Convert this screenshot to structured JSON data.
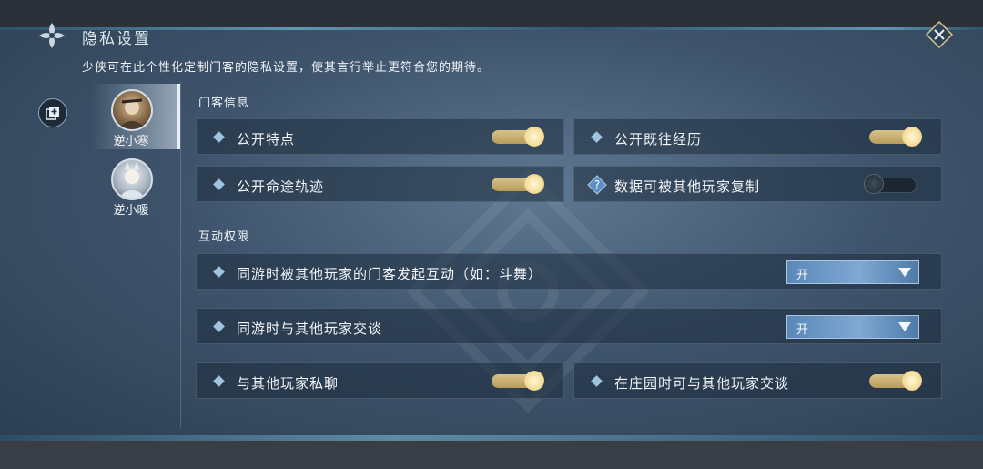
{
  "header": {
    "title": "隐私设置",
    "subtitle": "少侠可在此个性化定制门客的隐私设置，使其言行举止更符合您的期待。"
  },
  "sidebar": {
    "characters": [
      {
        "name": "逆小寒",
        "active": true
      },
      {
        "name": "逆小暖",
        "active": false
      }
    ]
  },
  "sections": {
    "info": {
      "label": "门客信息",
      "items": [
        {
          "label": "公开特点",
          "state": "on"
        },
        {
          "label": "公开既往经历",
          "state": "on"
        },
        {
          "label": "公开命途轨迹",
          "state": "on"
        },
        {
          "label": "数据可被其他玩家复制",
          "state": "off",
          "icon": "question-diamond-icon"
        }
      ]
    },
    "interaction": {
      "label": "互动权限",
      "rows": [
        {
          "label": "同游时被其他玩家的门客发起互动（如：斗舞）",
          "value": "开"
        },
        {
          "label": "同游时与其他玩家交谈",
          "value": "开"
        }
      ],
      "toggles": [
        {
          "label": "与其他玩家私聊",
          "state": "on"
        },
        {
          "label": "在庄园时可与其他玩家交谈",
          "state": "on"
        }
      ]
    }
  },
  "colors": {
    "accent": "#7fa8d2",
    "toggle_on": "#d8c28a",
    "panel": "#3f556d"
  }
}
